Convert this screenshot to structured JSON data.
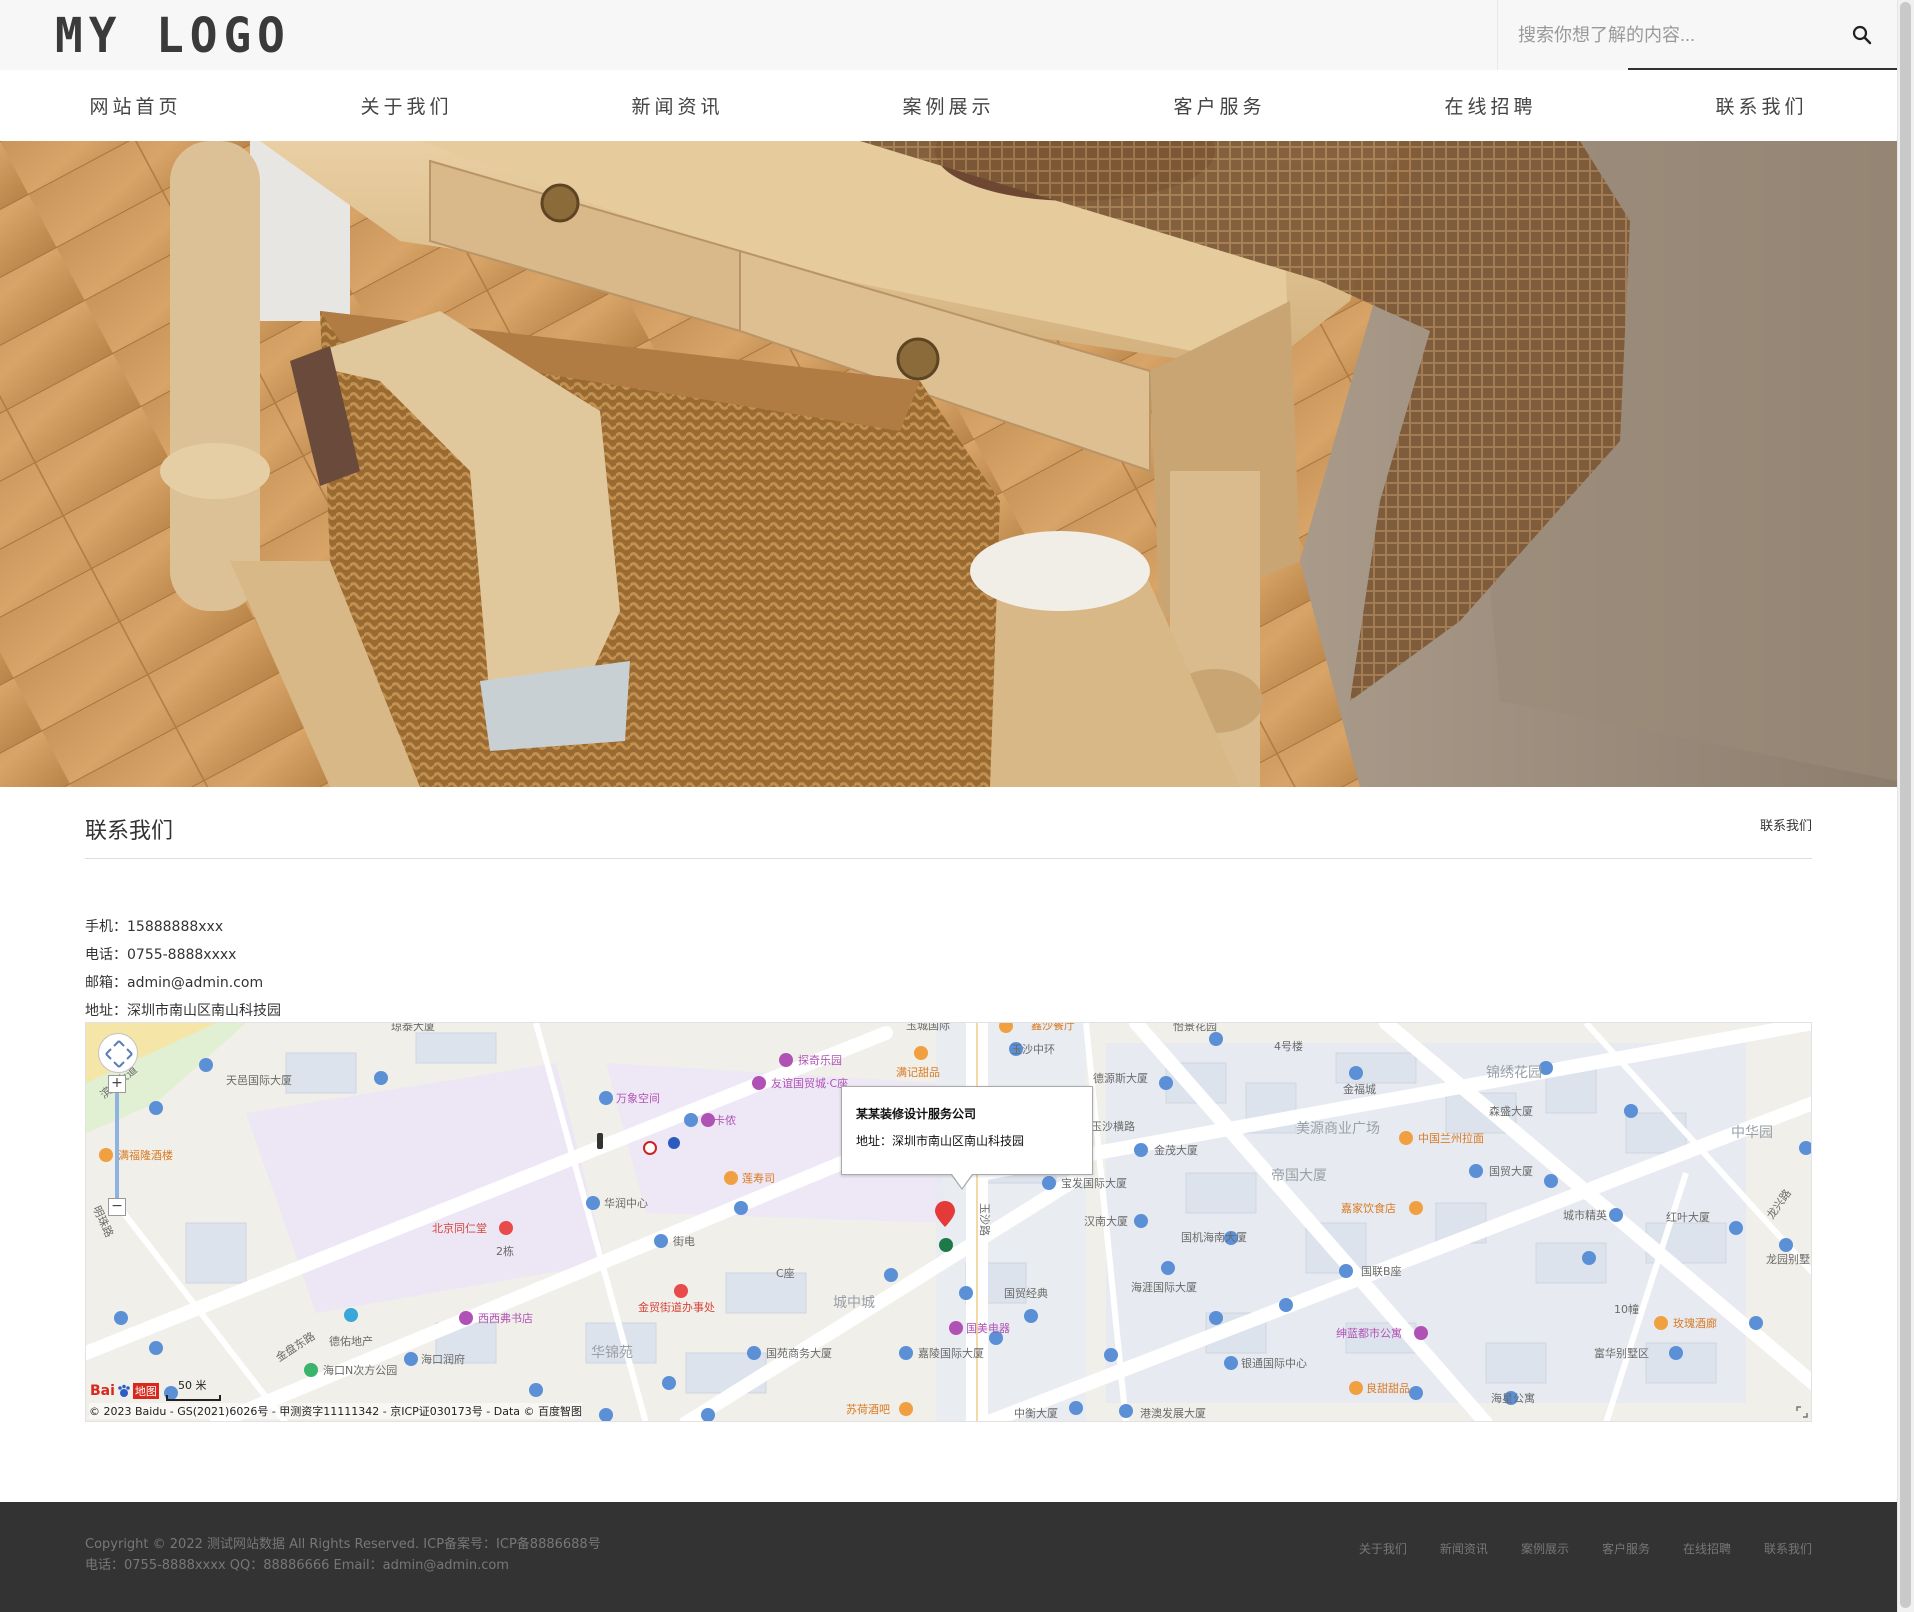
{
  "header": {
    "logo": "MY LOGO",
    "search_placeholder": "搜索你想了解的内容..."
  },
  "nav": {
    "items": [
      {
        "label": "网站首页"
      },
      {
        "label": "关于我们"
      },
      {
        "label": "新闻资讯"
      },
      {
        "label": "案例展示"
      },
      {
        "label": "客户服务"
      },
      {
        "label": "在线招聘"
      },
      {
        "label": "联系我们"
      }
    ]
  },
  "section": {
    "title": "联系我们",
    "breadcrumb": "联系我们"
  },
  "contact": {
    "mobile": "手机：15888888xxx",
    "phone": "电话：0755-8888xxxx",
    "email": "邮箱：admin@admin.com",
    "address": "地址：深圳市南山区南山科技园"
  },
  "map": {
    "popup_title": "某某装修设计服务公司",
    "popup_address": "地址：深圳市南山区南山科技园",
    "copyright": "© 2023 Baidu - GS(2021)6026号 - 甲测资字11111342 - 京ICP证030173号 - Data © 百度智图",
    "scale": "50 米",
    "brand_bai": "Bai",
    "brand_map": "地图",
    "labels": {
      "l1": "琼泰大厦",
      "l2": "天邑国际大厦",
      "l3": "万象空间",
      "l4": "探奇乐园",
      "l5": "友谊国贸城·C座",
      "l6": "迪卡侬",
      "l7": "满记甜品",
      "l8": "玉沙中环",
      "l9": "德源斯大厦",
      "l10": "怡景花园",
      "l11": "4号楼",
      "l12": "金福城",
      "l13": "锦绣花园",
      "l14": "森盛大厦",
      "l15": "美源商业广场",
      "l16": "中国兰州拉面",
      "l17": "中华园",
      "l18": "金茂大厦",
      "l19": "帝国大厦",
      "l20": "国贸大厦",
      "l21": "满福隆酒楼",
      "l22": "莲寿司",
      "l23": "街电",
      "l24": "华润中心",
      "l25": "宝发国际大厦",
      "l26": "汉南大厦",
      "l27": "嘉家饮食店",
      "l28": "城市精英",
      "l29": "红叶大厦",
      "l30": "龙兴路",
      "l31": "北京同仁堂",
      "l32": "2栋",
      "l33": "国机海南大厦",
      "l34": "龙园别墅",
      "l35": "明珠路",
      "l36": "C座",
      "l37": "国联B座",
      "l38": "海涯国际大厦",
      "l39": "国贸经典",
      "l40": "城中城",
      "l41": "金贸街道办事处",
      "l42": "西西弗书店",
      "l43": "德佑地产",
      "l44": "海口润府",
      "l45": "华锦苑",
      "l46": "国美电器",
      "l47": "绅蓝都市公寓",
      "l48": "10幢",
      "l49": "玫瑰酒廊",
      "l50": "海口N次方公园",
      "l51": "国苑商务大厦",
      "l52": "嘉陵国际大厦",
      "l53": "银通国际中心",
      "l54": "富华别墅区",
      "l55": "良甜甜品",
      "l56": "海星公寓",
      "l57": "苏荷酒吧",
      "l58": "中衡大厦",
      "l59": "港澳发展大厦",
      "l60": "金盘东路",
      "l61": "玉沙路",
      "l62": "滨海大道",
      "l63": "玉沙横路",
      "l64": "鑫沙餐厅",
      "l65": "玉城国际"
    }
  },
  "footer": {
    "copyright": "Copyright © 2022 测试网站数据 All Rights Reserved.   ICP备案号：ICP备8886688号",
    "contact": "电话：0755-8888xxxx  QQ：88886666  Email：admin@admin.com",
    "links": [
      {
        "label": "关于我们"
      },
      {
        "label": "新闻资讯"
      },
      {
        "label": "案例展示"
      },
      {
        "label": "客户服务"
      },
      {
        "label": "在线招聘"
      },
      {
        "label": "联系我们"
      }
    ]
  }
}
